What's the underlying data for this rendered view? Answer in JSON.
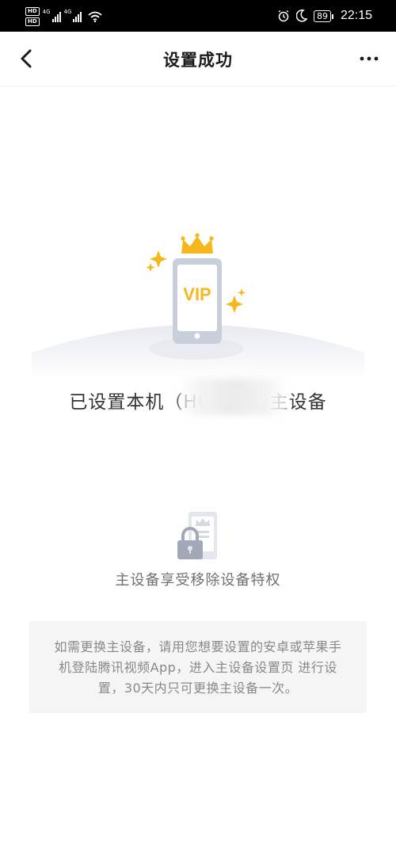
{
  "status_bar": {
    "hd_badges": [
      "HD",
      "HD"
    ],
    "network_labels": [
      "4G",
      "4G"
    ],
    "battery": "89",
    "time": "22:15",
    "icons": [
      "alarm-icon",
      "moon-icon",
      "wifi-icon"
    ]
  },
  "nav": {
    "title": "设置成功",
    "back_icon": "chevron-left-icon",
    "more_icon": "more-dots-icon"
  },
  "hero": {
    "badge_text": "VIP",
    "colors": {
      "gold": "#F5B71B",
      "phone": "#C9CEDB",
      "screen": "#FFFFFF"
    }
  },
  "main_message": "已设置本机（HUA                    ）为主设备",
  "feature": {
    "icon": "phone-lock-icon",
    "label": "主设备享受移除设备特权"
  },
  "tip": {
    "text": "如需更换主设备，请用您想要设置的安卓或苹果手机登陆腾讯视频App，进入主设备设置页 进行设置，30天内只可更换主设备一次。"
  }
}
